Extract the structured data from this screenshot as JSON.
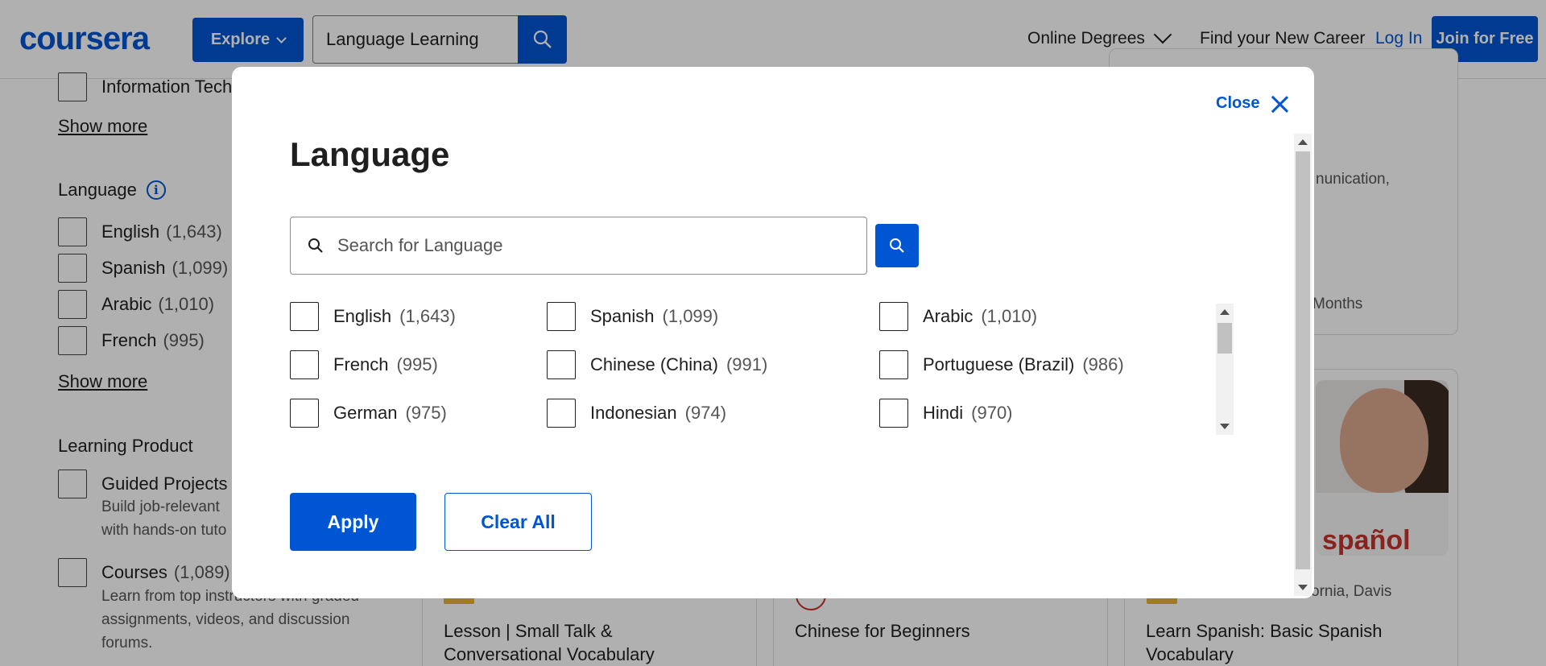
{
  "header": {
    "logo": "coursera",
    "explore_label": "Explore",
    "search_value": "Language Learning",
    "nav_degrees": "Online Degrees",
    "nav_career": "Find your New Career",
    "login_label": "Log In",
    "join_label": "Join for Free",
    "brand_color": "#0056d2"
  },
  "filters": {
    "subject_partial": "Information Tech",
    "show_more_1": "Show more",
    "language_heading": "Language",
    "languages": [
      {
        "label": "English",
        "count": "(1,643)"
      },
      {
        "label": "Spanish",
        "count": "(1,099)"
      },
      {
        "label": "Arabic",
        "count": "(1,010)"
      },
      {
        "label": "French",
        "count": "(995)"
      }
    ],
    "show_more_2": "Show more",
    "learning_product_heading": "Learning Product",
    "guided_projects": {
      "label": "Guided Projects",
      "desc_1": "Build job-relevant",
      "desc_2": "with hands-on tuto"
    },
    "courses": {
      "label": "Courses",
      "count": "(1,089)",
      "desc_1": "Learn from top instructors with graded",
      "desc_2": "assignments, videos, and discussion",
      "desc_3": "forums."
    }
  },
  "cards": {
    "snippet_1": "nunication,",
    "snippet_2": "Months",
    "card_1_title_1": "Lesson | Small Talk &",
    "card_1_title_2": "Conversational Vocabulary",
    "card_2_title": "Chinese for Beginners",
    "card_3_partner": "ornia, Davis",
    "card_3_title_1": "Learn Spanish: Basic Spanish",
    "card_3_title_2": "Vocabulary",
    "card_3_image_text": "spañol"
  },
  "modal": {
    "close_label": "Close",
    "title": "Language",
    "search_placeholder": "Search for Language",
    "options": [
      {
        "label": "English",
        "count": "(1,643)"
      },
      {
        "label": "Spanish",
        "count": "(1,099)"
      },
      {
        "label": "Arabic",
        "count": "(1,010)"
      },
      {
        "label": "French",
        "count": "(995)"
      },
      {
        "label": "Chinese (China)",
        "count": "(991)"
      },
      {
        "label": "Portuguese (Brazil)",
        "count": "(986)"
      },
      {
        "label": "German",
        "count": "(975)"
      },
      {
        "label": "Indonesian",
        "count": "(974)"
      },
      {
        "label": "Hindi",
        "count": "(970)"
      }
    ],
    "apply_label": "Apply",
    "clear_label": "Clear All"
  }
}
